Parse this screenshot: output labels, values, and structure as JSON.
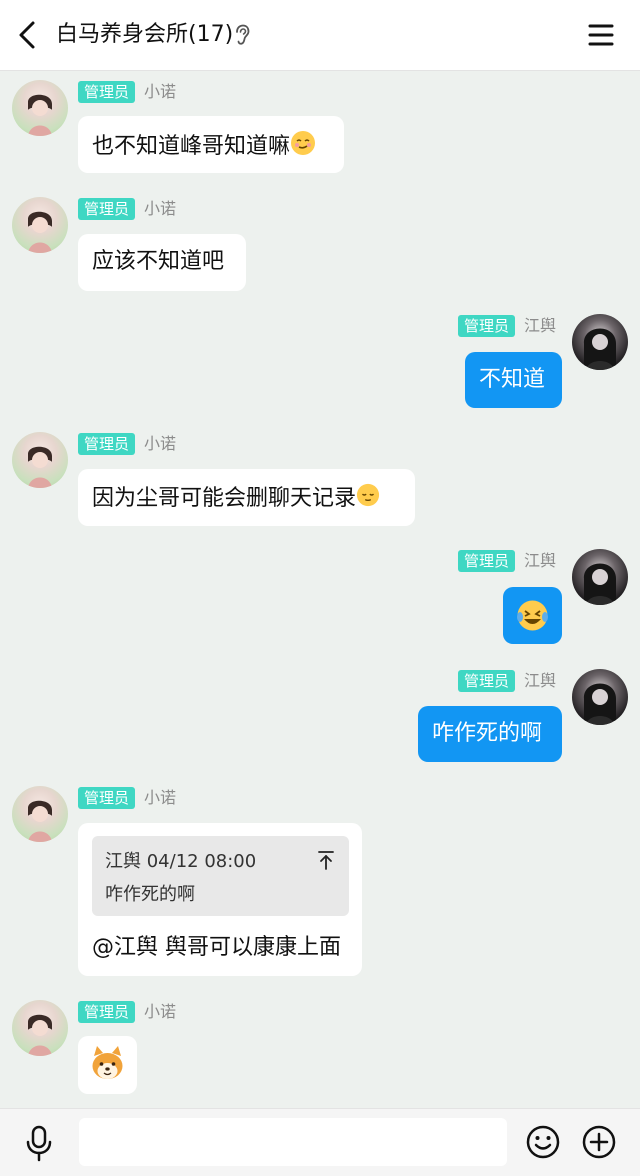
{
  "header": {
    "title": "白马养身会所(17)",
    "back_icon": "chevron-left-icon",
    "ear_icon": "ear-icon",
    "menu_icon": "hamburger-menu-icon"
  },
  "badge_color": "#3fd7c3",
  "outgoing_bubble_color": "#1296f3",
  "messages": [
    {
      "side": "left",
      "badge": "管理员",
      "sender": "小诺",
      "text": "也不知道峰哥知道嘛",
      "emoji": "smiling-blush-emoji"
    },
    {
      "side": "left",
      "badge": "管理员",
      "sender": "小诺",
      "text": "应该不知道吧"
    },
    {
      "side": "right",
      "badge": "管理员",
      "sender": "江舆",
      "text": "不知道"
    },
    {
      "side": "left",
      "badge": "管理员",
      "sender": "小诺",
      "text": "因为尘哥可能会删聊天记录",
      "emoji": "relieved-face-emoji"
    },
    {
      "side": "right",
      "badge": "管理员",
      "sender": "江舆",
      "sticker": "laughing-tears-sticker"
    },
    {
      "side": "right",
      "badge": "管理员",
      "sender": "江舆",
      "text": "咋作死的啊"
    },
    {
      "side": "left",
      "badge": "管理员",
      "sender": "小诺",
      "quote": {
        "author": "江舆",
        "time": "04/12 08:00",
        "text": "咋作死的啊"
      },
      "text": "@江舆 舆哥可以康康上面"
    },
    {
      "side": "left",
      "badge": "管理员",
      "sender": "小诺",
      "sticker": "shiba-dog-sticker"
    }
  ],
  "input_bar": {
    "mic_icon": "microphone-icon",
    "placeholder": "",
    "emoji_icon": "smiley-icon",
    "plus_icon": "plus-circle-icon"
  }
}
